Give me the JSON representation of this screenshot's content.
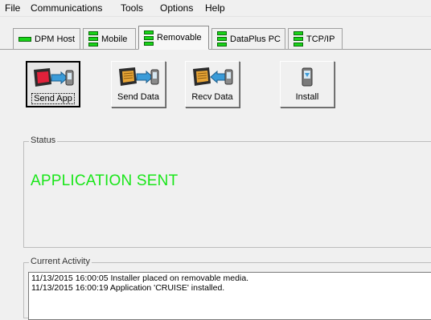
{
  "menu": [
    "File",
    "Communications",
    "Tools",
    "Options",
    "Help"
  ],
  "tabs": [
    {
      "label": "DPM Host",
      "icon": "led-horizontal-icon",
      "active": false
    },
    {
      "label": "Mobile",
      "icon": "led-stack-icon",
      "active": false
    },
    {
      "label": "Removable",
      "icon": "led-stack-icon",
      "active": true
    },
    {
      "label": "DataPlus PC",
      "icon": "led-stack-icon",
      "active": false
    },
    {
      "label": "TCP/IP",
      "icon": "led-stack-icon",
      "active": false
    }
  ],
  "toolbar": {
    "send_app": "Send App",
    "send_data": "Send Data",
    "recv_data": "Recv Data",
    "install": "Install"
  },
  "status": {
    "title": "Status",
    "message": "APPLICATION SENT",
    "color": "#19e619"
  },
  "activity": {
    "title": "Current Activity",
    "lines": [
      "11/13/2015 16:00:05 Installer placed on removable media.",
      "11/13/2015 16:00:19 Application 'CRUISE' installed."
    ]
  }
}
